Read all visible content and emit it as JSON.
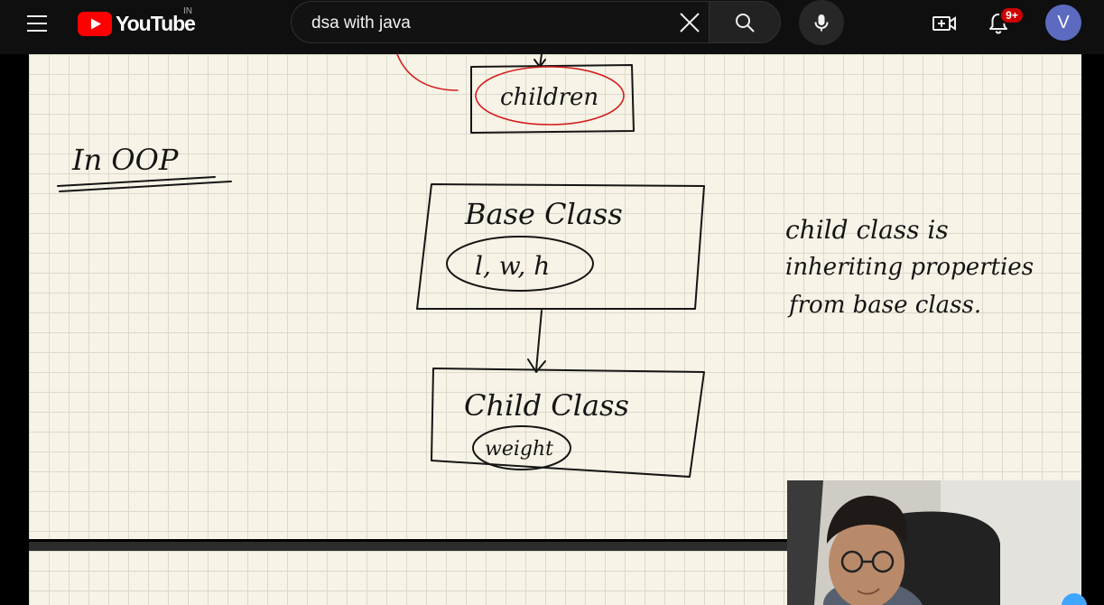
{
  "header": {
    "logo_text": "YouTube",
    "country_code": "IN",
    "search": {
      "value": "dsa with java",
      "placeholder": "Search"
    },
    "notifications_badge": "9+",
    "avatar_letter": "V"
  },
  "video": {
    "notes": {
      "top_box_label": "children",
      "heading": "In OOP",
      "base_class_title": "Base Class",
      "base_class_props": "l, w, h",
      "child_class_title": "Child Class",
      "child_class_props": "weight",
      "side_note_line1": "child class is",
      "side_note_line2": "inheriting properties",
      "side_note_line3": "from base class."
    }
  },
  "colors": {
    "background": "#0f0f0f",
    "brand_red": "#ff0000",
    "avatar": "#5c6bc0",
    "paper": "#f7f3e6",
    "ink": "#151515",
    "annotation_red": "#d21d1d"
  },
  "icons": [
    "menu-icon",
    "youtube-logo-icon",
    "clear-icon",
    "search-icon",
    "microphone-icon",
    "create-video-icon",
    "bell-icon"
  ]
}
